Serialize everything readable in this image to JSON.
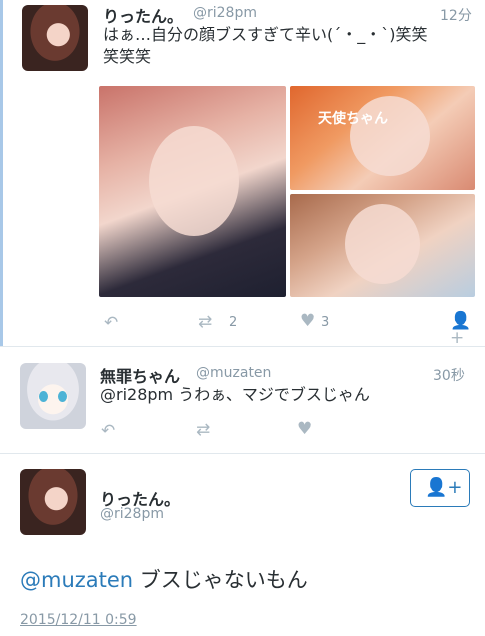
{
  "tweet1": {
    "name": "りったん。",
    "handle": "@ri28pm",
    "time": "12分",
    "text_line1": "はぁ…自分の顔ブスすぎて辛い(´・_・`)笑笑",
    "text_line2": "笑笑笑",
    "photo_caption": "天使ちゃん",
    "retweets": "2",
    "likes": "3"
  },
  "tweet2": {
    "name": "無罪ちゃん",
    "handle": "@muzaten",
    "time": "30秒",
    "mention": "@ri28pm",
    "text": " うわぁ、マジでブスじゃん"
  },
  "tweet3": {
    "name": "りったん。",
    "handle": "@ri28pm",
    "mention": "@muzaten",
    "text": " ブスじゃないもん",
    "date": "2015/12/11 0:59"
  },
  "icons": {
    "reply": "reply-icon",
    "retweet": "retweet-icon",
    "like": "heart-icon",
    "follow": "add-user-icon"
  },
  "colors": {
    "link": "#2b7bb9",
    "muted": "#8899a6",
    "icon": "#aab8c2"
  }
}
